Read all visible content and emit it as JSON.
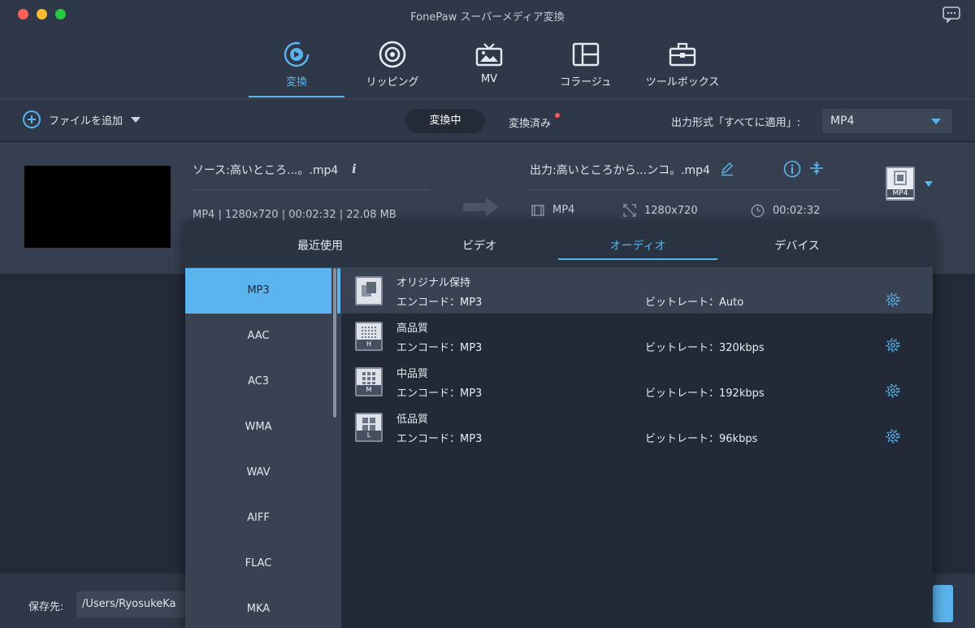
{
  "window": {
    "title": "FonePaw スーパーメディア変換"
  },
  "nav": {
    "tabs": [
      {
        "label": "変換",
        "icon": "convert-icon"
      },
      {
        "label": "リッピング",
        "icon": "ripper-icon"
      },
      {
        "label": "MV",
        "icon": "tv-icon"
      },
      {
        "label": "コラージュ",
        "icon": "collage-icon"
      },
      {
        "label": "ツールボックス",
        "icon": "toolbox-icon"
      }
    ],
    "active": 0
  },
  "toolbar": {
    "add_file_label": "ファイルを追加",
    "segments": {
      "converting": "変換中",
      "converted": "変換済み"
    },
    "output_format_label": "出力形式「すべてに適用」:",
    "output_format_value": "MP4"
  },
  "file": {
    "source_name": "ソース:高いところ...。.mp4",
    "source_meta": "MP4 | 1280x720 | 00:02:32 | 22.08 MB",
    "output_name": "出力:高いところから...ンコ。.mp4",
    "output_format": "MP4",
    "output_resolution": "1280x720",
    "output_duration": "00:02:32",
    "format_badge": "MP4"
  },
  "format_panel": {
    "tabs": [
      "最近使用",
      "ビデオ",
      "オーディオ",
      "デバイス"
    ],
    "active_tab": 2,
    "formats": [
      "MP3",
      "AAC",
      "AC3",
      "WMA",
      "WAV",
      "AIFF",
      "FLAC",
      "MKA"
    ],
    "active_format": 0,
    "presets": [
      {
        "name": "オリジナル保持",
        "encode": "エンコード：MP3",
        "bitrate": "ビットレート：Auto",
        "badge": ""
      },
      {
        "name": "高品質",
        "encode": "エンコード：MP3",
        "bitrate": "ビットレート：320kbps",
        "badge": "H"
      },
      {
        "name": "中品質",
        "encode": "エンコード：MP3",
        "bitrate": "ビットレート：192kbps",
        "badge": "M"
      },
      {
        "name": "低品質",
        "encode": "エンコード：MP3",
        "bitrate": "ビットレート：96kbps",
        "badge": "L"
      }
    ]
  },
  "bottom": {
    "save_label": "保存先:",
    "save_path": "/Users/RyosukeKa"
  },
  "colors": {
    "accent": "#5bb4ee",
    "notify": "#ff5a4b"
  }
}
